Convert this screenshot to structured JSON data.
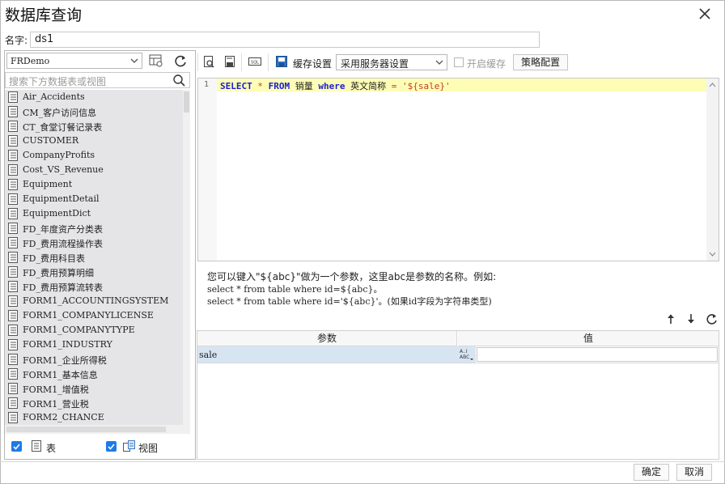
{
  "window": {
    "title": "数据库查询"
  },
  "name_field": {
    "label": "名字:",
    "value": "ds1"
  },
  "left": {
    "connection": "FRDemo",
    "search_placeholder": "搜索下方数据表或视图",
    "tables": [
      "Air_Accidents",
      "CM_客户访问信息",
      "CT_食堂订餐记录表",
      "CUSTOMER",
      "CompanyProfits",
      "Cost_VS_Revenue",
      "Equipment",
      "EquipmentDetail",
      "EquipmentDict",
      "FD_年度资产分类表",
      "FD_费用流程操作表",
      "FD_费用科目表",
      "FD_费用预算明细",
      "FD_费用预算流转表",
      "FORM1_ACCOUNTINGSYSTEM",
      "FORM1_COMPANYLICENSE",
      "FORM1_COMPANYTYPE",
      "FORM1_INDUSTRY",
      "FORM1_企业所得税",
      "FORM1_基本信息",
      "FORM1_增值税",
      "FORM1_营业税",
      "FORM2_CHANCE"
    ],
    "filter_table_label": "表",
    "filter_view_label": "视图",
    "filter_table_checked": true,
    "filter_view_checked": true
  },
  "toolbar": {
    "cache_label": "缓存设置",
    "cache_option": "采用服务器设置",
    "enable_cache_label": "开启缓存",
    "enable_cache_checked": false,
    "strategy_button": "策略配置"
  },
  "editor": {
    "line_number": "1",
    "sql_tokens": {
      "select": "SELECT",
      "star": "*",
      "from": "FROM",
      "table": "销量",
      "where": "where",
      "column": "英文简称",
      "eq": "=",
      "value": "'${sale}'"
    }
  },
  "hint": {
    "line1": "您可以键入\"${abc}\"做为一个参数，这里abc是参数的名称。例如:",
    "line2": "select * from table where id=${abc}。",
    "line3": "select * from table where id='${abc}'。(如果id字段为字符串类型)"
  },
  "params": {
    "headers": {
      "param": "参数",
      "value": "值"
    },
    "rows": [
      {
        "name": "sale",
        "value": ""
      }
    ]
  },
  "footer": {
    "ok": "确定",
    "cancel": "取消"
  },
  "colors": {
    "accent_checkbox": "#1e7ae6",
    "highlight_line": "#fdfdb5",
    "keyword": "#1c1cd8",
    "string": "#c23e2c",
    "list_bg": "#e5e5e8",
    "selected_row": "#d7e5f2"
  }
}
